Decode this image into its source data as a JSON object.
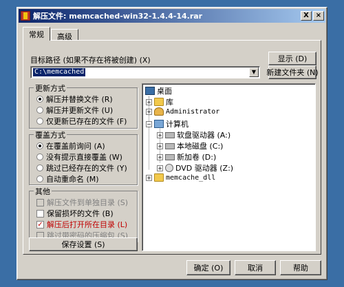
{
  "window": {
    "title": "解压文件: memcached-win32-1.4.4-14.rar",
    "close_glyph": "?",
    "help_glyph": "X"
  },
  "tabs": [
    {
      "label": "常规",
      "active": true
    },
    {
      "label": "高级",
      "active": false
    }
  ],
  "target": {
    "label": "目标路径 (如果不存在将被创建) (X)",
    "value": "C:\\memcached",
    "show_button": "显示 (D)",
    "new_folder_button": "新建文件夹 (N)"
  },
  "update_mode": {
    "title": "更新方式",
    "options": [
      {
        "label": "解压并替换文件 (R)",
        "selected": true
      },
      {
        "label": "解压并更新文件 (U)",
        "selected": false
      },
      {
        "label": "仅更新已存在的文件 (F)",
        "selected": false
      }
    ]
  },
  "overwrite_mode": {
    "title": "覆盖方式",
    "options": [
      {
        "label": "在覆盖前询问 (A)",
        "selected": true
      },
      {
        "label": "没有提示直接覆盖 (W)",
        "selected": false
      },
      {
        "label": "跳过已经存在的文件 (Y)",
        "selected": false
      },
      {
        "label": "自动重命名 (M)",
        "selected": false
      }
    ]
  },
  "misc": {
    "title": "其他",
    "options": [
      {
        "label": "解压文件到单独目录 (S)",
        "checked": false,
        "enabled": false
      },
      {
        "label": "保留损坏的文件 (B)",
        "checked": false,
        "enabled": true
      },
      {
        "label": "解压后打开所在目录 (L)",
        "checked": true,
        "enabled": true
      },
      {
        "label": "跳过带密码的压缩包 (S)",
        "checked": false,
        "enabled": false
      }
    ]
  },
  "save_settings_button": "保存设置 (S)",
  "tree": {
    "items": [
      {
        "label": "桌面"
      },
      {
        "label": "库"
      },
      {
        "label": "Administrator"
      },
      {
        "label": "计算机"
      },
      {
        "label": "软盘驱动器 (A:)"
      },
      {
        "label": "本地磁盘 (C:)"
      },
      {
        "label": "新加卷 (D:)"
      },
      {
        "label": "DVD 驱动器 (Z:)"
      },
      {
        "label": "memcache_dll"
      }
    ]
  },
  "buttons": {
    "ok": "确定 (O)",
    "cancel": "取消",
    "help": "帮助"
  }
}
